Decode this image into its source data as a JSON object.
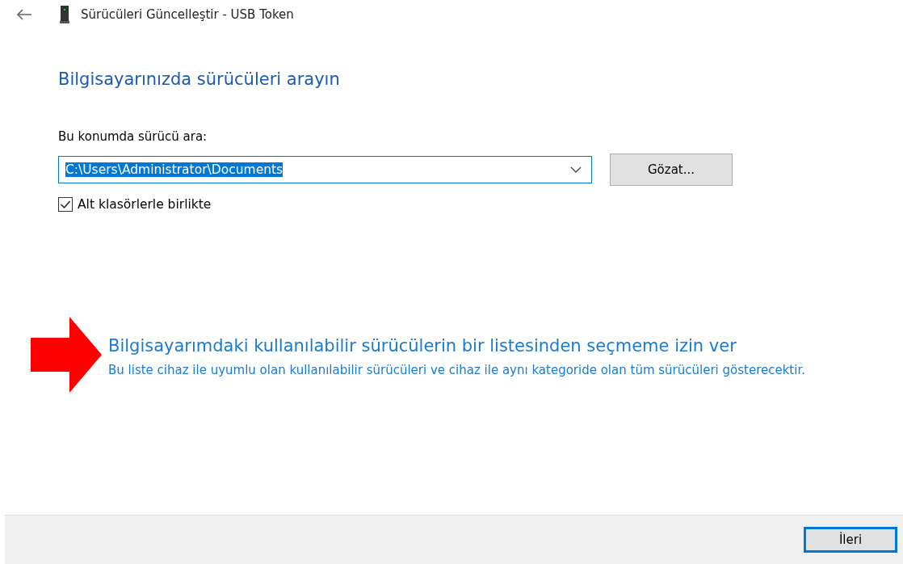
{
  "window": {
    "title": "Sürücüleri Güncelleştir - USB Token"
  },
  "heading": "Bilgisayarınızda sürücüleri arayın",
  "location": {
    "label": "Bu konumda sürücü ara:",
    "value": "C:\\Users\\Administrator\\Documents",
    "text_selected": true,
    "browse_button": "Gözat..."
  },
  "subfolders": {
    "label": "Alt klasörlerle birlikte",
    "checked": true
  },
  "pick_option": {
    "title": "Bilgisayarımdaki kullanılabilir sürücülerin bir listesinden seçmeme izin ver",
    "description": "Bu liste cihaz ile uyumlu olan kullanılabilir sürücüleri ve cihaz ile aynı kategoride olan tüm sürücüleri gösterecektir."
  },
  "footer": {
    "buttons": [
      {
        "label": "İleri",
        "default": true
      }
    ]
  }
}
